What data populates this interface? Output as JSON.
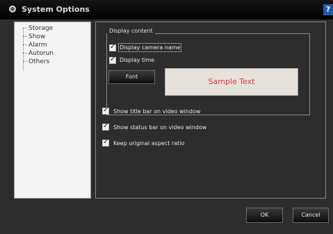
{
  "window": {
    "title": "System Options",
    "help_icon": "?"
  },
  "sidebar": {
    "items": [
      {
        "label": "Storage"
      },
      {
        "label": "Show"
      },
      {
        "label": "Alarm"
      },
      {
        "label": "Autorun"
      },
      {
        "label": "Others"
      }
    ]
  },
  "display_content": {
    "title": "Display content",
    "options": [
      {
        "label": "Display camera name",
        "checked": true
      },
      {
        "label": "Display time",
        "checked": true
      }
    ],
    "font_button": "Font",
    "sample_text": "Sample Text",
    "sample_text_color": "#d53b35"
  },
  "options": [
    {
      "label": "Show title bar on video window",
      "checked": true
    },
    {
      "label": "Show status bar on video window",
      "checked": true
    },
    {
      "label": "Keep original aspect ratio",
      "checked": true
    }
  ],
  "buttons": {
    "ok": "OK",
    "cancel": "Cancel"
  }
}
